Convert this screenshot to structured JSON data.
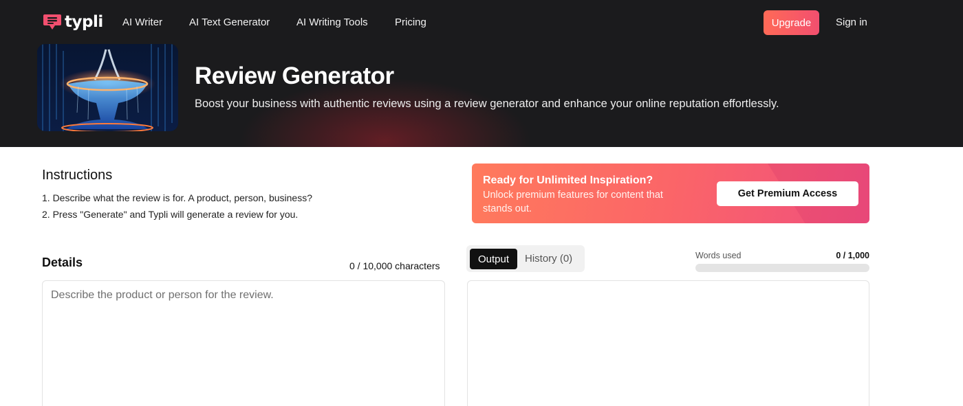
{
  "nav": {
    "logo_text": "typli",
    "links": [
      "AI Writer",
      "AI Text Generator",
      "AI Writing Tools",
      "Pricing"
    ],
    "upgrade_label": "Upgrade",
    "signin_label": "Sign in"
  },
  "hero": {
    "image": "fountain-illustration",
    "title": "Review Generator",
    "subtitle": "Boost your business with authentic reviews using a review generator and enhance your online reputation effortlessly."
  },
  "instructions": {
    "title": "Instructions",
    "steps": [
      "1. Describe what the review is for. A product, person, business?",
      "2. Press \"Generate\" and Typli will generate a review for you."
    ]
  },
  "promo": {
    "title": "Ready for Unlimited Inspiration?",
    "text": "Unlock premium features for content that stands out.",
    "button_label": "Get Premium Access"
  },
  "details": {
    "title": "Details",
    "char_count": "0 / 10,000 characters",
    "placeholder": "Describe the product or person for the review.",
    "value": ""
  },
  "output": {
    "tabs": [
      {
        "label": "Output",
        "active": true
      },
      {
        "label": "History (0)",
        "active": false
      }
    ],
    "words_used_label": "Words used",
    "words_used_value": "0 / 1,000",
    "words_used_fraction": 0
  },
  "colors": {
    "header_bg": "#1b1b1d",
    "accent": "#f24f6f",
    "accent_orange": "#ff6a57"
  }
}
